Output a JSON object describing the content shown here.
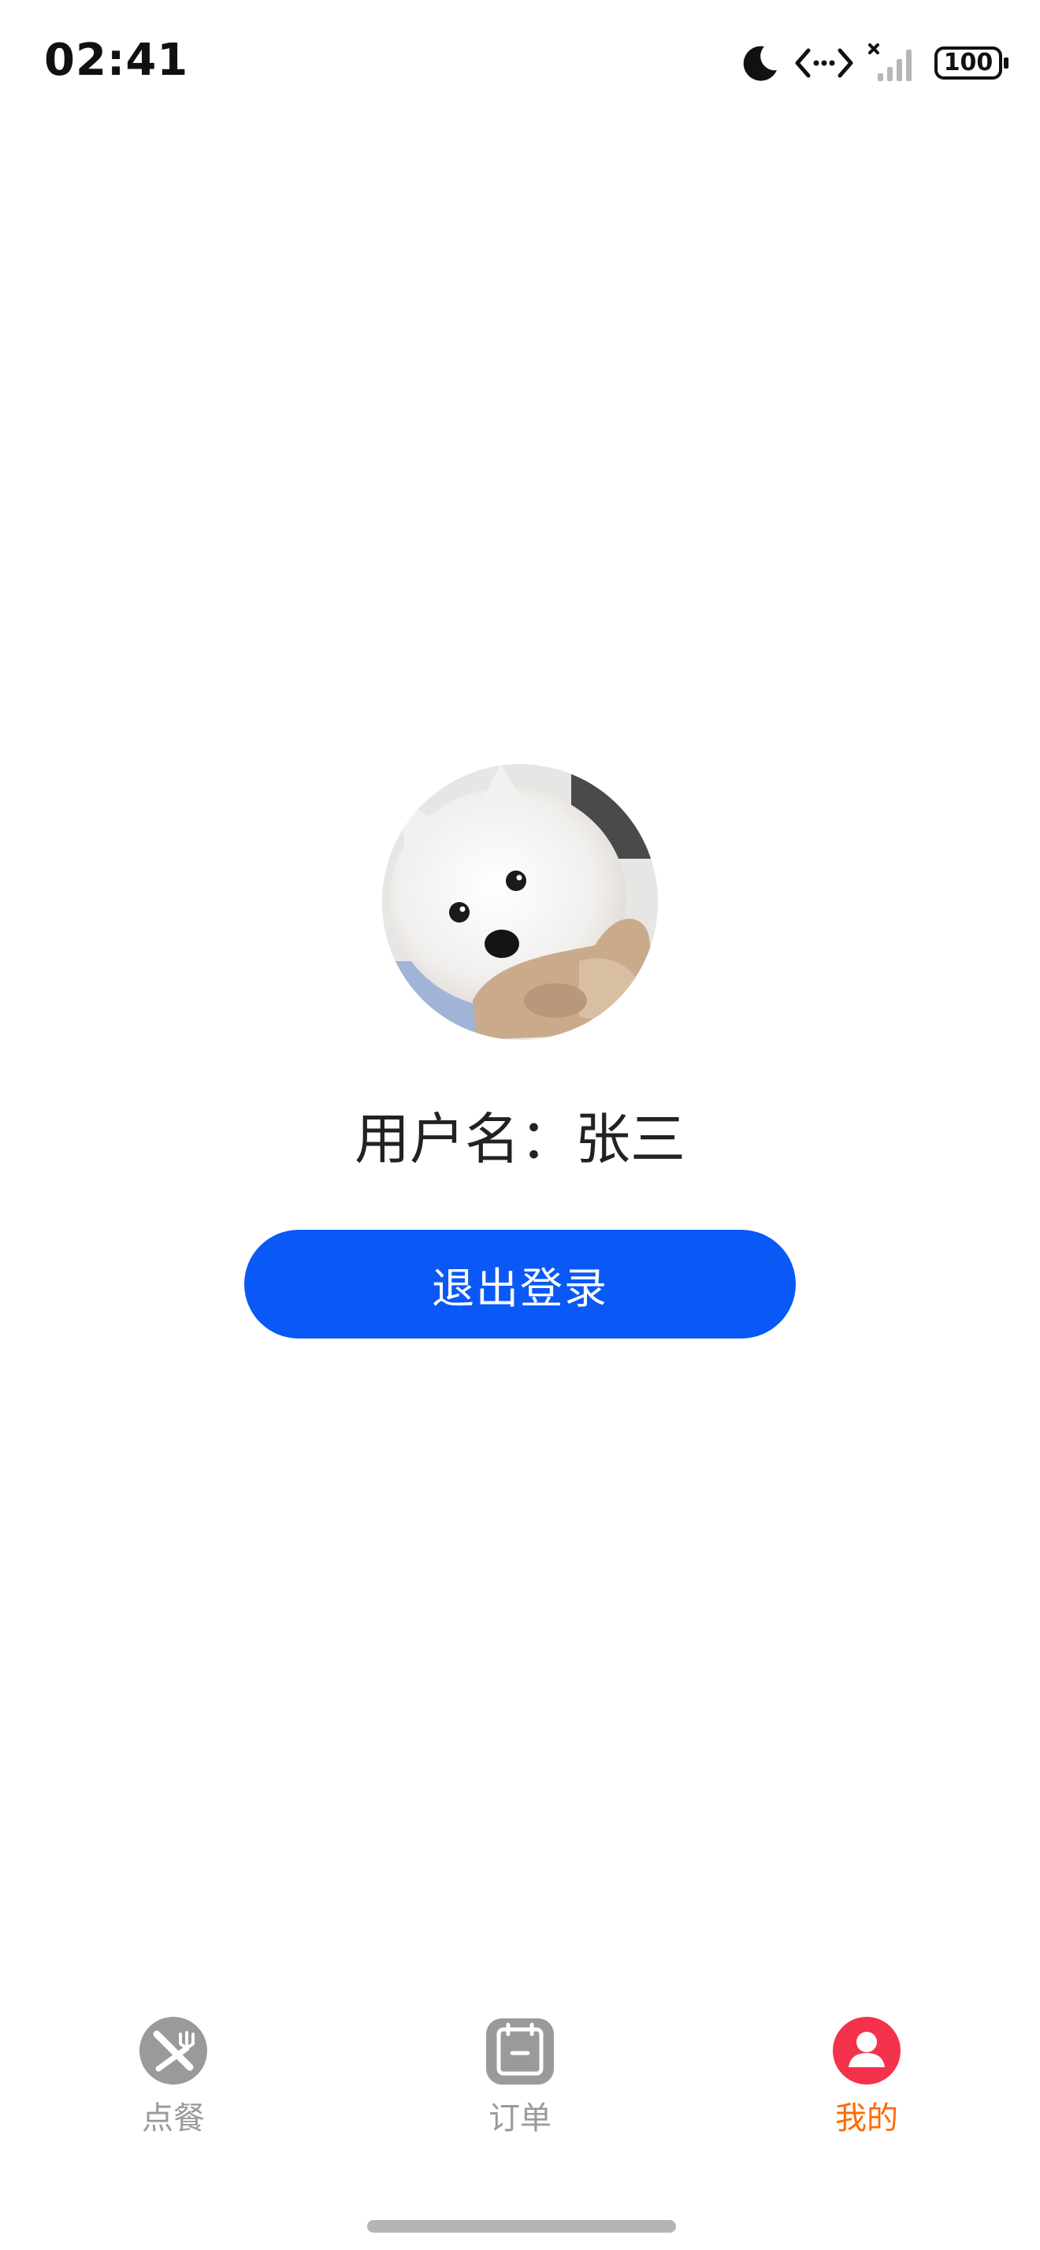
{
  "status_bar": {
    "time": "02:41",
    "battery": "100",
    "icons": [
      "moon-icon",
      "data-arrows-icon",
      "signal-icon",
      "battery-icon"
    ]
  },
  "profile": {
    "avatar": "avatar-dog-photo",
    "username_label": "用户名：",
    "username_value": "张三",
    "logout_label": "退出登录"
  },
  "tabs": [
    {
      "label": "点餐",
      "icon": "utensils-icon",
      "active": false
    },
    {
      "label": "订单",
      "icon": "order-list-icon",
      "active": false
    },
    {
      "label": "我的",
      "icon": "user-icon",
      "active": true
    }
  ],
  "colors": {
    "primary_button": "#0a59f7",
    "active_tab_label": "#ff6a00",
    "active_tab_icon": "#f5324b",
    "inactive_tab": "#9a9a9a"
  }
}
